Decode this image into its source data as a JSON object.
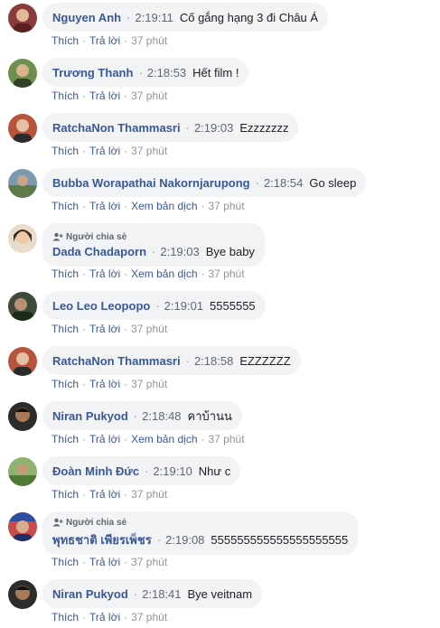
{
  "labels": {
    "like": "Thích",
    "reply": "Trả lời",
    "see_translation": "Xem bản dịch",
    "shared_badge": "Người chia sẻ"
  },
  "colors": {
    "author": "#385898",
    "bubble": "#f2f3f5",
    "meta": "#90949c"
  },
  "comments": [
    {
      "author": "Nguyen Anh",
      "time": "2:19:11",
      "text": "Cố gắng hạng 3 đi Châu Á",
      "ago": "37 phút",
      "translate": false,
      "badge": false
    },
    {
      "author": "Trương Thanh",
      "time": "2:18:53",
      "text": "Hết film !",
      "ago": "37 phút",
      "translate": false,
      "badge": false
    },
    {
      "author": "RatchaNon Thammasri",
      "time": "2:19:03",
      "text": "Ezzzzzzz",
      "ago": "37 phút",
      "translate": false,
      "badge": false
    },
    {
      "author": "Bubba Worapathai Nakornjarupong",
      "time": "2:18:54",
      "text": "Go sleep",
      "ago": "37 phút",
      "translate": true,
      "badge": false
    },
    {
      "author": "Dada Chadaporn",
      "time": "2:19:03",
      "text": "Bye baby",
      "ago": "37 phút",
      "translate": true,
      "badge": true
    },
    {
      "author": "Leo Leo Leopopo",
      "time": "2:19:01",
      "text": "5555555",
      "ago": "37 phút",
      "translate": false,
      "badge": false
    },
    {
      "author": "RatchaNon Thammasri",
      "time": "2:18:58",
      "text": "EZZZZZZ",
      "ago": "37 phút",
      "translate": false,
      "badge": false
    },
    {
      "author": "Niran Pukyod",
      "time": "2:18:48",
      "text": "คาบ้านน",
      "ago": "37 phút",
      "translate": true,
      "badge": false
    },
    {
      "author": "Đoàn Minh Đức",
      "time": "2:19:10",
      "text": "Như c",
      "ago": "37 phút",
      "translate": false,
      "badge": false
    },
    {
      "author": "พุทธชาติ เพียรเพ็ชร",
      "time": "2:19:08",
      "text": "555555555555555555555",
      "ago": "37 phút",
      "translate": false,
      "badge": true
    },
    {
      "author": "Niran Pukyod",
      "time": "2:18:41",
      "text": "Bye veitnam",
      "ago": "37 phút",
      "translate": false,
      "badge": false
    }
  ]
}
